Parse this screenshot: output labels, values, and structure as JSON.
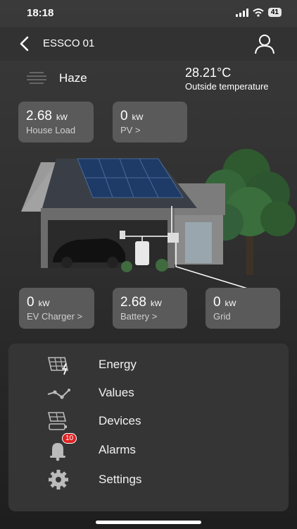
{
  "status": {
    "time": "18:18",
    "battery": "41"
  },
  "nav": {
    "title": "ESSCO 01"
  },
  "weather": {
    "condition": "Haze",
    "temperature": "28.21°C",
    "temperature_label": "Outside temperature"
  },
  "tiles": {
    "house_load": {
      "value": "2.68",
      "unit": "kW",
      "label": "House Load"
    },
    "pv": {
      "value": "0",
      "unit": "kW",
      "label": "PV >"
    },
    "ev_charger": {
      "value": "0",
      "unit": "kW",
      "label": "EV Charger >"
    },
    "battery": {
      "value": "2.68",
      "unit": "kW",
      "label": "Battery >"
    },
    "grid": {
      "value": "0",
      "unit": "kW",
      "label": "Grid"
    }
  },
  "menu": {
    "items": [
      {
        "label": "Energy",
        "icon": "solar-panel-bolt-icon"
      },
      {
        "label": "Values",
        "icon": "line-graph-icon"
      },
      {
        "label": "Devices",
        "icon": "devices-icon"
      },
      {
        "label": "Alarms",
        "icon": "bell-icon",
        "badge": "10"
      },
      {
        "label": "Settings",
        "icon": "gear-icon"
      }
    ]
  },
  "colors": {
    "background": "#2e2e2e",
    "tile": "#5a5a5a",
    "panel": "#353535",
    "badge": "#e02020"
  }
}
